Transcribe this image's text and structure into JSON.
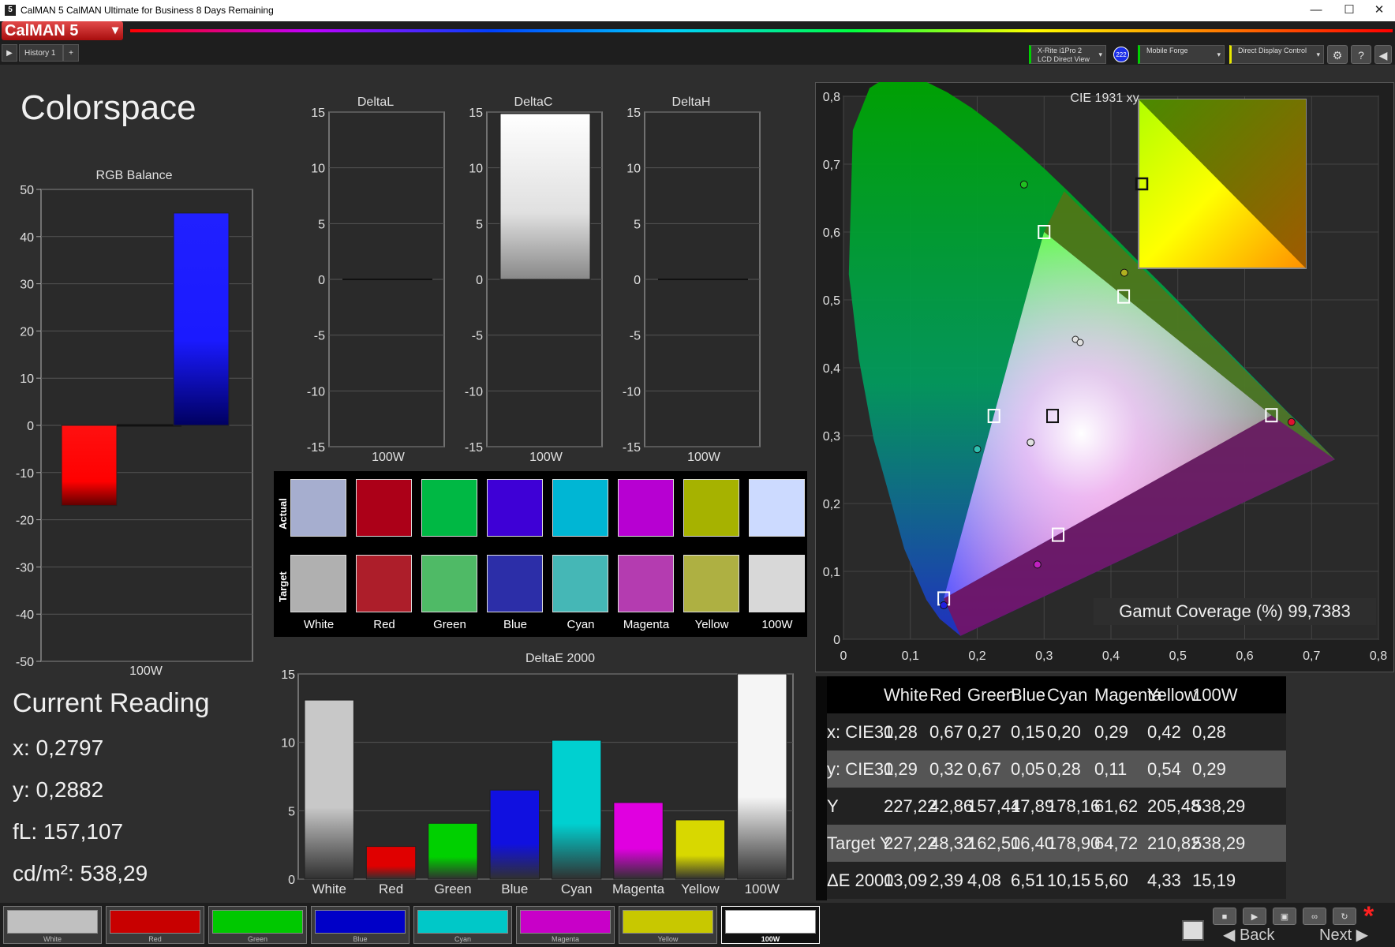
{
  "window": {
    "title": "CalMAN 5 CalMAN Ultimate for Business 8 Days Remaining",
    "minimize": "—",
    "maximize": "☐",
    "close": "✕"
  },
  "brand": {
    "logo": "CalMAN 5",
    "dropdown": "▾"
  },
  "tabs": [
    {
      "label": "History 1"
    },
    {
      "label": "+"
    }
  ],
  "devices": {
    "meter_line1": "X-Rite i1Pro 2",
    "meter_line2": "LCD Direct View",
    "meter_badge": "222",
    "source": "Mobile Forge",
    "display": "Direct Display Control"
  },
  "toolbar": {
    "settings": "⚙",
    "help": "?",
    "collapse": "◀"
  },
  "page": {
    "title": "Colorspace"
  },
  "rgb_balance": {
    "title": "RGB Balance",
    "ticks": [
      "50",
      "40",
      "30",
      "20",
      "10",
      "0",
      "-10",
      "-20",
      "-30",
      "-40",
      "-50"
    ],
    "category": "100W",
    "colors": {
      "red": "#ff0000",
      "blue": "#1a1aff"
    },
    "chart_data": {
      "type": "bar",
      "categories": [
        "100W"
      ],
      "series": [
        {
          "values": [
            -17
          ]
        },
        {
          "values": [
            0
          ]
        },
        {
          "values": [
            45
          ]
        }
      ],
      "ylim": [
        -50,
        50
      ]
    }
  },
  "delta_charts": [
    {
      "title": "DeltaL",
      "category": "100W",
      "value": 0,
      "ticks": [
        "15",
        "10",
        "5",
        "0",
        "-5",
        "-10",
        "-15"
      ]
    },
    {
      "title": "DeltaC",
      "category": "100W",
      "value": 15,
      "ticks": [
        "15",
        "10",
        "5",
        "0",
        "-5",
        "-10",
        "-15"
      ]
    },
    {
      "title": "DeltaH",
      "category": "100W",
      "value": 0,
      "ticks": [
        "15",
        "10",
        "5",
        "0",
        "-5",
        "-10",
        "-15"
      ]
    }
  ],
  "swatches": {
    "row_actual": "Actual",
    "row_target": "Target",
    "items": [
      {
        "label": "White",
        "actual": "#a6aecf",
        "target": "#b0b0b0"
      },
      {
        "label": "Red",
        "actual": "#ac0018",
        "target": "#ad1e2a"
      },
      {
        "label": "Green",
        "actual": "#00b844",
        "target": "#4fba66"
      },
      {
        "label": "Blue",
        "actual": "#3e00d6",
        "target": "#2c2ea8"
      },
      {
        "label": "Cyan",
        "actual": "#00b6d4",
        "target": "#45b7b6"
      },
      {
        "label": "Magenta",
        "actual": "#b700d2",
        "target": "#b43cb0"
      },
      {
        "label": "Yellow",
        "actual": "#a6b200",
        "target": "#aeb042"
      },
      {
        "label": "100W",
        "actual": "#ccdaff",
        "target": "#d8d8d8"
      }
    ]
  },
  "deltae": {
    "title": "DeltaE 2000",
    "ticks": [
      "15",
      "10",
      "5",
      "0"
    ],
    "chart_data": {
      "type": "bar",
      "categories": [
        "White",
        "Red",
        "Green",
        "Blue",
        "Cyan",
        "Magenta",
        "Yellow",
        "100W"
      ],
      "values": [
        13.09,
        2.39,
        4.08,
        6.51,
        10.15,
        5.6,
        4.33,
        15.19
      ],
      "ylim": [
        0,
        15
      ]
    },
    "bar_colors": [
      "#c8c8c8",
      "#e00000",
      "#00d000",
      "#1010e0",
      "#00d0d0",
      "#e000e0",
      "#d8d800",
      "#f5f5f5"
    ]
  },
  "cie": {
    "title": "CIE 1931 xy",
    "x_ticks": [
      "0",
      "0,1",
      "0,2",
      "0,3",
      "0,4",
      "0,5",
      "0,6",
      "0,7",
      "0,8"
    ],
    "y_ticks": [
      "0,8",
      "0,7",
      "0,6",
      "0,5",
      "0,4",
      "0,3",
      "0,2",
      "0,1",
      "0"
    ],
    "gamut_label": "Gamut Coverage (%) 99,7383",
    "chart_data": {
      "type": "scatter",
      "xlim": [
        0,
        0.8
      ],
      "ylim": [
        0,
        0.8
      ],
      "targets": [
        {
          "name": "Red",
          "x": 0.64,
          "y": 0.33
        },
        {
          "name": "Green",
          "x": 0.3,
          "y": 0.6
        },
        {
          "name": "Blue",
          "x": 0.15,
          "y": 0.06
        },
        {
          "name": "Cyan",
          "x": 0.225,
          "y": 0.329
        },
        {
          "name": "Magenta",
          "x": 0.321,
          "y": 0.154
        },
        {
          "name": "Yellow",
          "x": 0.419,
          "y": 0.505
        },
        {
          "name": "White",
          "x": 0.3127,
          "y": 0.329
        }
      ],
      "actuals": [
        {
          "name": "White",
          "x": 0.28,
          "y": 0.29
        },
        {
          "name": "Red",
          "x": 0.67,
          "y": 0.32
        },
        {
          "name": "Green",
          "x": 0.27,
          "y": 0.67
        },
        {
          "name": "Blue",
          "x": 0.15,
          "y": 0.05
        },
        {
          "name": "Cyan",
          "x": 0.2,
          "y": 0.28
        },
        {
          "name": "Magenta",
          "x": 0.29,
          "y": 0.11
        },
        {
          "name": "Yellow",
          "x": 0.42,
          "y": 0.54
        },
        {
          "name": "100W",
          "x": 0.28,
          "y": 0.29
        }
      ]
    }
  },
  "reading": {
    "title": "Current Reading",
    "x": "x: 0,2797",
    "y": "y: 0,2882",
    "fl": "fL: 157,107",
    "cdm2": "cd/m²: 538,29"
  },
  "table": {
    "headers": [
      "",
      "White",
      "Red",
      "Green",
      "Blue",
      "Cyan",
      "Magenta",
      "Yellow",
      "100W"
    ],
    "rows": [
      [
        "x: CIE31",
        "0,28",
        "0,67",
        "0,27",
        "0,15",
        "0,20",
        "0,29",
        "0,42",
        "0,28"
      ],
      [
        "y: CIE31",
        "0,29",
        "0,32",
        "0,67",
        "0,05",
        "0,28",
        "0,11",
        "0,54",
        "0,29"
      ],
      [
        "Y",
        "227,22",
        "42,86",
        "157,44",
        "17,89",
        "178,16",
        "61,62",
        "205,48",
        "538,29"
      ],
      [
        "Target Y",
        "227,22",
        "48,32",
        "162,50",
        "16,40",
        "178,90",
        "64,72",
        "210,82",
        "538,29"
      ],
      [
        "ΔE 2000",
        "13,09",
        "2,39",
        "4,08",
        "6,51",
        "10,15",
        "5,60",
        "4,33",
        "15,19"
      ]
    ]
  },
  "footer": {
    "buttons": [
      {
        "label": "White",
        "color": "#c0c0c0"
      },
      {
        "label": "Red",
        "color": "#c80000"
      },
      {
        "label": "Green",
        "color": "#00c800"
      },
      {
        "label": "Blue",
        "color": "#0000c8"
      },
      {
        "label": "Cyan",
        "color": "#00c8c8"
      },
      {
        "label": "Magenta",
        "color": "#c800c8"
      },
      {
        "label": "Yellow",
        "color": "#c8c800"
      },
      {
        "label": "100W",
        "color": "#ffffff"
      }
    ],
    "back": "Back",
    "next": "Next"
  }
}
